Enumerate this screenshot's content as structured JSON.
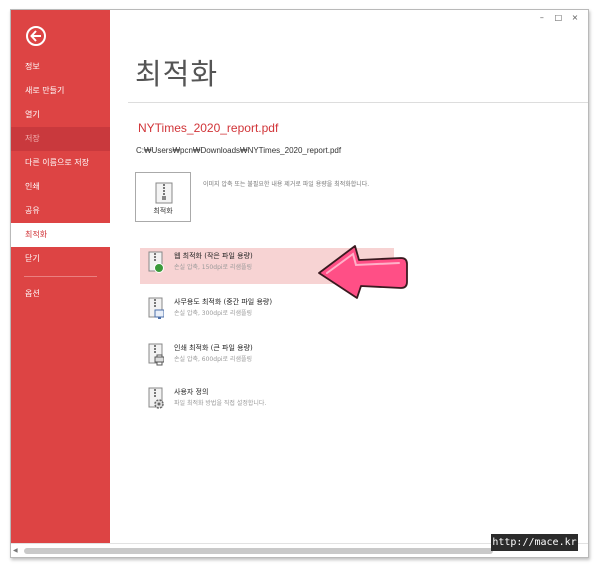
{
  "window": {
    "controls": [
      "–",
      "□",
      "×"
    ]
  },
  "sidebar": {
    "back_icon": "arrow-left-circle-icon",
    "items": [
      {
        "label": "정보"
      },
      {
        "label": "새로 만들기"
      },
      {
        "label": "열기"
      },
      {
        "label": "저장"
      },
      {
        "label": "다른 이름으로 저장"
      },
      {
        "label": "인쇄"
      },
      {
        "label": "공유"
      },
      {
        "label": "최적화"
      },
      {
        "label": "닫기"
      },
      {
        "label": "옵션"
      }
    ]
  },
  "main": {
    "title": "최적화",
    "document_name": "NYTimes_2020_report.pdf",
    "document_path": "C:₩Users₩pcn₩Downloads₩NYTimes_2020_report.pdf",
    "optimize_button_label": "최적화",
    "optimize_description": "이미지 압축 또는 불필요한 내용 제거로 파일 용량을 최적화합니다.",
    "options": [
      {
        "title": "웹 최적화 (작은 파일 용량)",
        "subtitle": "손실 압축, 150dpi로 리샘플링",
        "icon": "web-globe-icon"
      },
      {
        "title": "사무용도 최적화 (중간 파일 용량)",
        "subtitle": "손실 압축, 300dpi로 리샘플링",
        "icon": "office-monitor-icon"
      },
      {
        "title": "인쇄 최적화 (큰 파일 용량)",
        "subtitle": "손실 압축, 600dpi로 리샘플링",
        "icon": "printer-icon"
      },
      {
        "title": "사용자 정의",
        "subtitle": "파일 최적화 방법을 직접 설정합니다.",
        "icon": "settings-gear-icon"
      }
    ]
  },
  "watermark": "http://mace.kr",
  "colors": {
    "accent": "#dd4444",
    "highlight": "#f7d3d3",
    "arrow": "#ff4f86"
  }
}
